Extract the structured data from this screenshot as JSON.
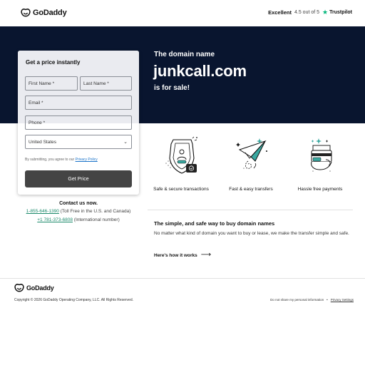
{
  "brand": {
    "name": "GoDaddy"
  },
  "rating": {
    "label": "Excellent",
    "score": "4.5 out of 5",
    "provider": "Trustpilot"
  },
  "hero": {
    "subtitle": "The domain name",
    "domain": "junkcall.com",
    "sale_text": "is for sale!",
    "background": "#09152f"
  },
  "form": {
    "title": "Get a price instantly",
    "first_name_placeholder": "First Name *",
    "last_name_placeholder": "Last Name *",
    "email_placeholder": "Email *",
    "phone_placeholder": "Phone *",
    "country_value": "United States",
    "consent_prefix": "By submitting, you agree to our",
    "privacy_link": "Privacy Policy",
    "submit_label": "Get Price",
    "submit_color": "#444444"
  },
  "contact": {
    "title": "Contact us now.",
    "phones": [
      {
        "number": "1-855-646-1390",
        "note": "(Toll Free in the U.S. and Canada)"
      },
      {
        "number": "+1 781-373-6808",
        "note": "(International number)"
      }
    ]
  },
  "features": [
    {
      "label": "Safe & secure transactions",
      "icon": "shield-icon"
    },
    {
      "label": "Fast & easy transfers",
      "icon": "paper-plane-icon"
    },
    {
      "label": "Hassle free payments",
      "icon": "wallet-icon"
    }
  ],
  "info": {
    "title": "The simple, and safe way to buy domain names",
    "body": "No matter what kind of domain you want to buy or lease, we make the transfer simple and safe.",
    "link": "Here's how it works"
  },
  "footer": {
    "copyright": "Copyright © 2026 GoDaddy Operating Company, LLC. All Rights Reserved.",
    "do_not_share": "Do not share my personal information",
    "separator": "•",
    "privacy_settings": "Privacy Settings"
  },
  "colors": {
    "accent_green": "#1b8a6b",
    "trustpilot_green": "#00b67a",
    "link_blue": "#1a73c9"
  }
}
